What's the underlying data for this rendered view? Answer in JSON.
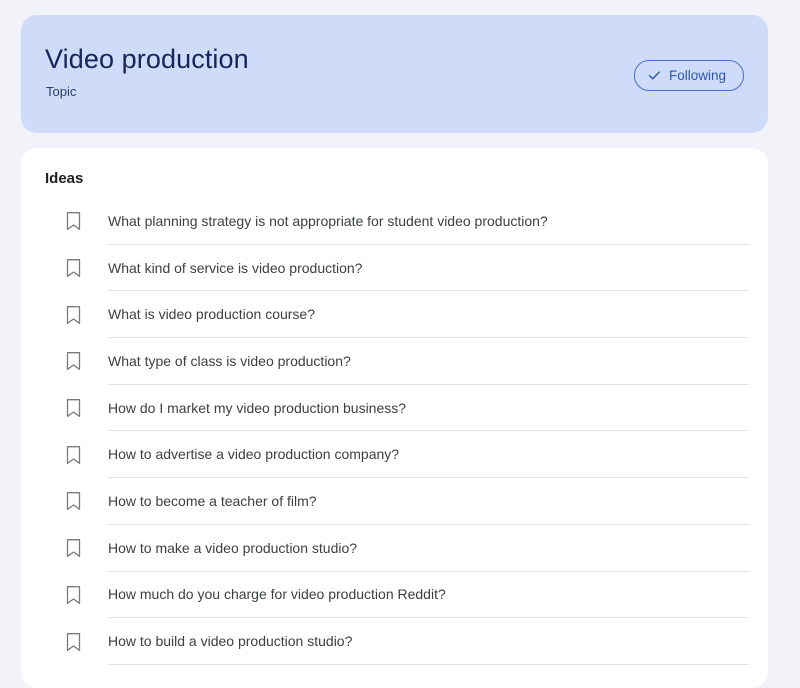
{
  "page": {
    "background_color": "#f1f3f9"
  },
  "topic_header": {
    "title": "Video production",
    "subtitle": "Topic",
    "card_color": "#cedcfa",
    "title_color": "#17255a",
    "follow_button": {
      "label": "Following",
      "icon": "check-icon",
      "accent_color": "#2f55b0",
      "border_color": "#4a6fc9",
      "state": "following"
    }
  },
  "ideas_section": {
    "heading": "Ideas",
    "item_icon": "bookmark-icon",
    "items": [
      {
        "text": "What planning strategy is not appropriate for student video production?"
      },
      {
        "text": "What kind of service is video production?"
      },
      {
        "text": "What is video production course?"
      },
      {
        "text": "What type of class is video production?"
      },
      {
        "text": "How do I market my video production business?"
      },
      {
        "text": "How to advertise a video production company?"
      },
      {
        "text": "How to become a teacher of film?"
      },
      {
        "text": "How to make a video production studio?"
      },
      {
        "text": "How much do you charge for video production Reddit?"
      },
      {
        "text": "How to build a video production studio?"
      }
    ]
  }
}
